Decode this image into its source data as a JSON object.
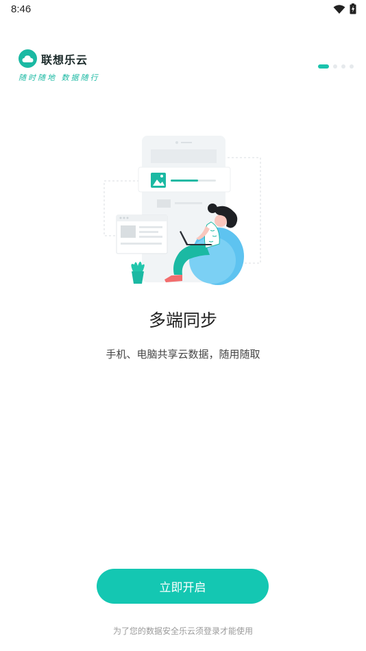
{
  "status_bar": {
    "time": "8:46",
    "icons": [
      "wifi-icon",
      "battery-icon"
    ]
  },
  "brand": {
    "name": "联想乐云",
    "slogan": "随时随地 数据随行",
    "logo_icon": "cloud-icon",
    "accent": "#1bb9a3"
  },
  "pager": {
    "total": 4,
    "current": 1
  },
  "onboarding": {
    "title": "多端同步",
    "description": "手机、电脑共享云数据，随用随取"
  },
  "actions": {
    "start_label": "立即开启",
    "button_color": "#14c7b2"
  },
  "footer": {
    "note": "为了您的数据安全乐云须登录才能使用"
  }
}
